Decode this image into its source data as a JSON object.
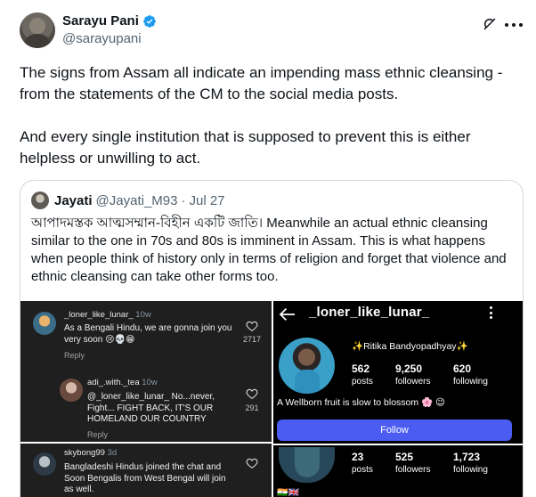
{
  "author": {
    "name": "Sarayu Pani",
    "handle": "@sarayupani",
    "verified": true,
    "actions": [
      "grok-icon",
      "more-icon"
    ]
  },
  "tweet": {
    "paragraph1": "The signs from Assam all indicate an impending mass ethnic cleansing - from the statements of the CM to the social media posts.",
    "paragraph2": "And every single institution that is supposed to prevent this is either helpless or unwilling to act."
  },
  "quote": {
    "name": "Jayati",
    "handle": "@Jayati_M93",
    "separator": "·",
    "date": "Jul 27",
    "text": "আপাদমস্তক আত্মসম্মান-বিহীন একটি জাতি। Meanwhile an actual ethnic cleansing similar to the one in 70s and 80s is imminent in Assam. This is what happens when people think of history only in terms of religion and forget that violence and ethnic cleansing can take other forms too."
  },
  "media_left": {
    "comments": [
      {
        "user": "_loner_like_lunar_",
        "time": "10w",
        "body": "As a Bengali Hindu, we are gonna join you very soon 😢💀😁",
        "reply": "Reply",
        "likes": "2717"
      },
      {
        "user": "adi_.with._tea",
        "time": "10w",
        "body": "@_loner_like_lunar_ No...never, Fight... FIGHT BACK, IT'S OUR HOMELAND OUR COUNTRY",
        "reply": "Reply",
        "likes": "291"
      },
      {
        "user": "skybong99",
        "time": "3d",
        "body": "Bangladeshi Hindus joined the chat and Soon Bengalis from West Bengal will join as well."
      }
    ]
  },
  "media_right": {
    "username": "_loner_like_lunar_",
    "display_name": "✨Ritika Bandyopadhyay✨",
    "stats": [
      {
        "num": "562",
        "label": "posts"
      },
      {
        "num": "9,250",
        "label": "followers"
      },
      {
        "num": "620",
        "label": "following"
      }
    ],
    "bio": "A Wellborn fruit is slow to blossom 🌸 😉",
    "follow_label": "Follow",
    "stats2": [
      {
        "num": "23",
        "label": "posts"
      },
      {
        "num": "525",
        "label": "followers"
      },
      {
        "num": "1,723",
        "label": "following"
      }
    ],
    "flags": "🇮🇳🇬🇧"
  },
  "colors": {
    "verified_blue": "#1d9bf0",
    "text_primary": "#0f1419",
    "text_secondary": "#536471",
    "follow_button": "#4a5cf2"
  }
}
